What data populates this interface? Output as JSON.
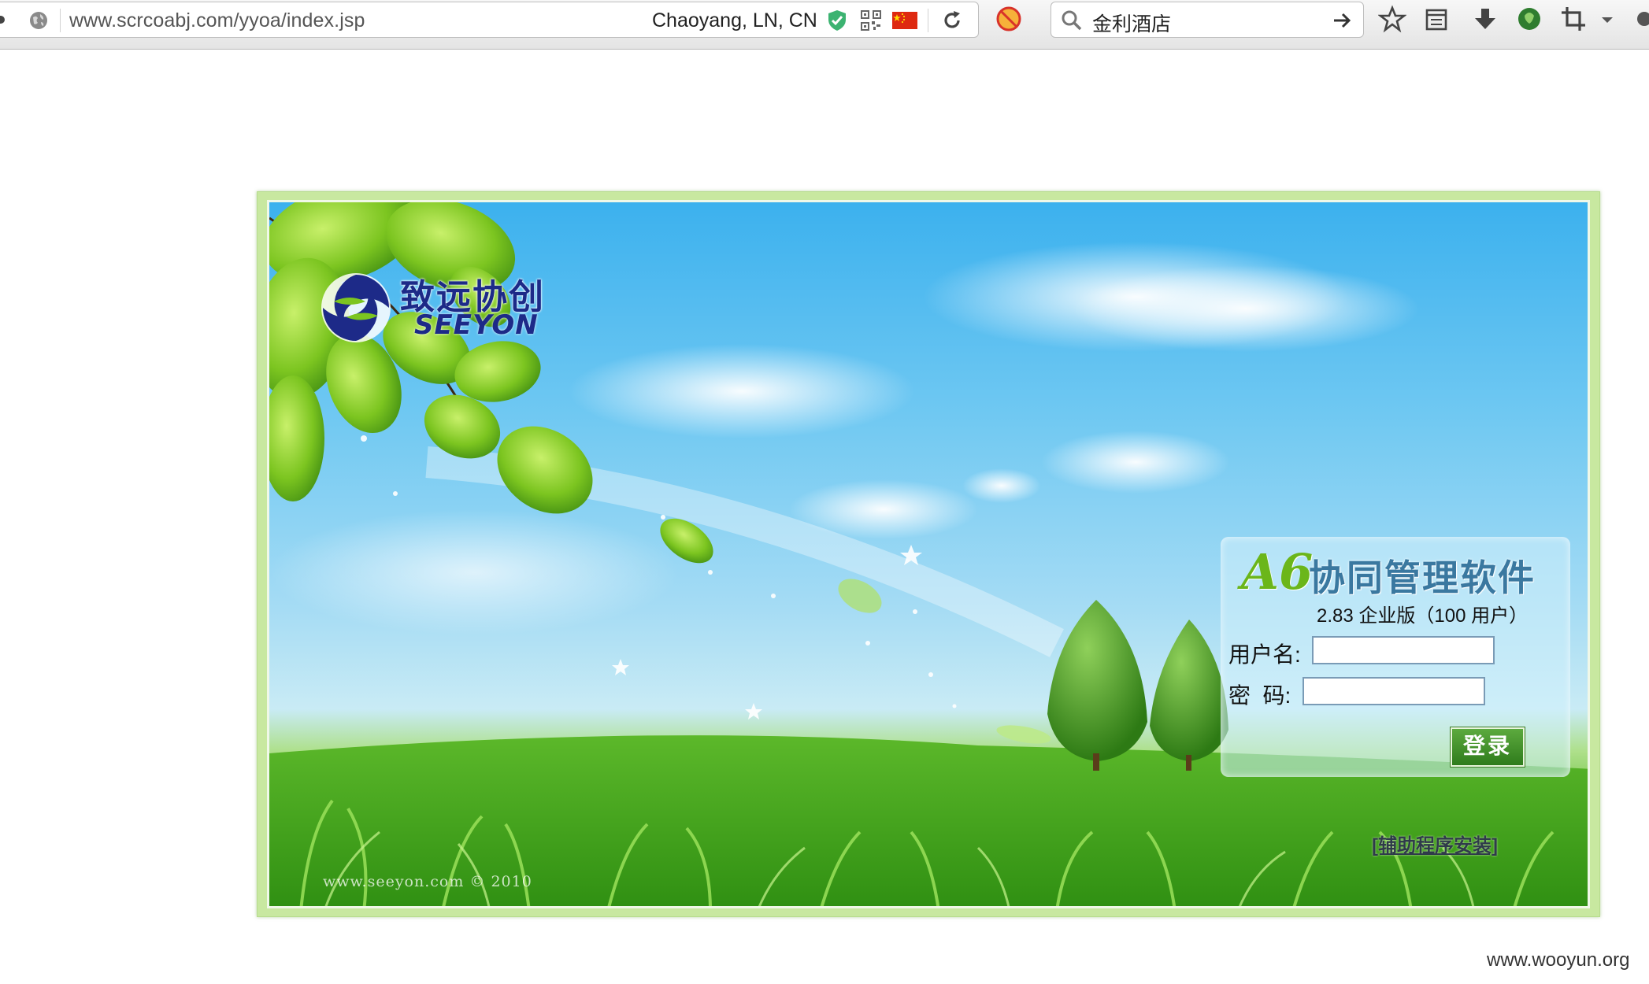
{
  "browser": {
    "url": "www.scrcoabj.com/yyoa/index.jsp",
    "location": "Chaoyang, LN, CN",
    "search_value": "金利酒店",
    "icons": [
      "globe-icon",
      "shield-icon",
      "qr-code-icon",
      "china-flag-icon",
      "reload-icon",
      "adblock-icon",
      "search-icon",
      "go-arrow-icon",
      "bookmark-star-icon",
      "reading-list-icon",
      "download-icon",
      "extension-icon",
      "crop-icon",
      "dropdown-icon"
    ],
    "colors": {
      "shield": "#3cb371",
      "flag": "#de2910"
    }
  },
  "page": {
    "logo": {
      "cn": "致远协创",
      "en": "SEEYON"
    },
    "product": {
      "mark": "A6",
      "title": "协同管理软件",
      "version": "2.83 企业版（100 用户）"
    },
    "login": {
      "username_label": "用户名:",
      "password_label": "密  码:",
      "username_value": "",
      "password_value": "",
      "submit_label": "登录"
    },
    "helper_link": "[辅助程序安装]",
    "copyright": "www.seeyon.com © 2010"
  },
  "watermark": "www.wooyun.org"
}
